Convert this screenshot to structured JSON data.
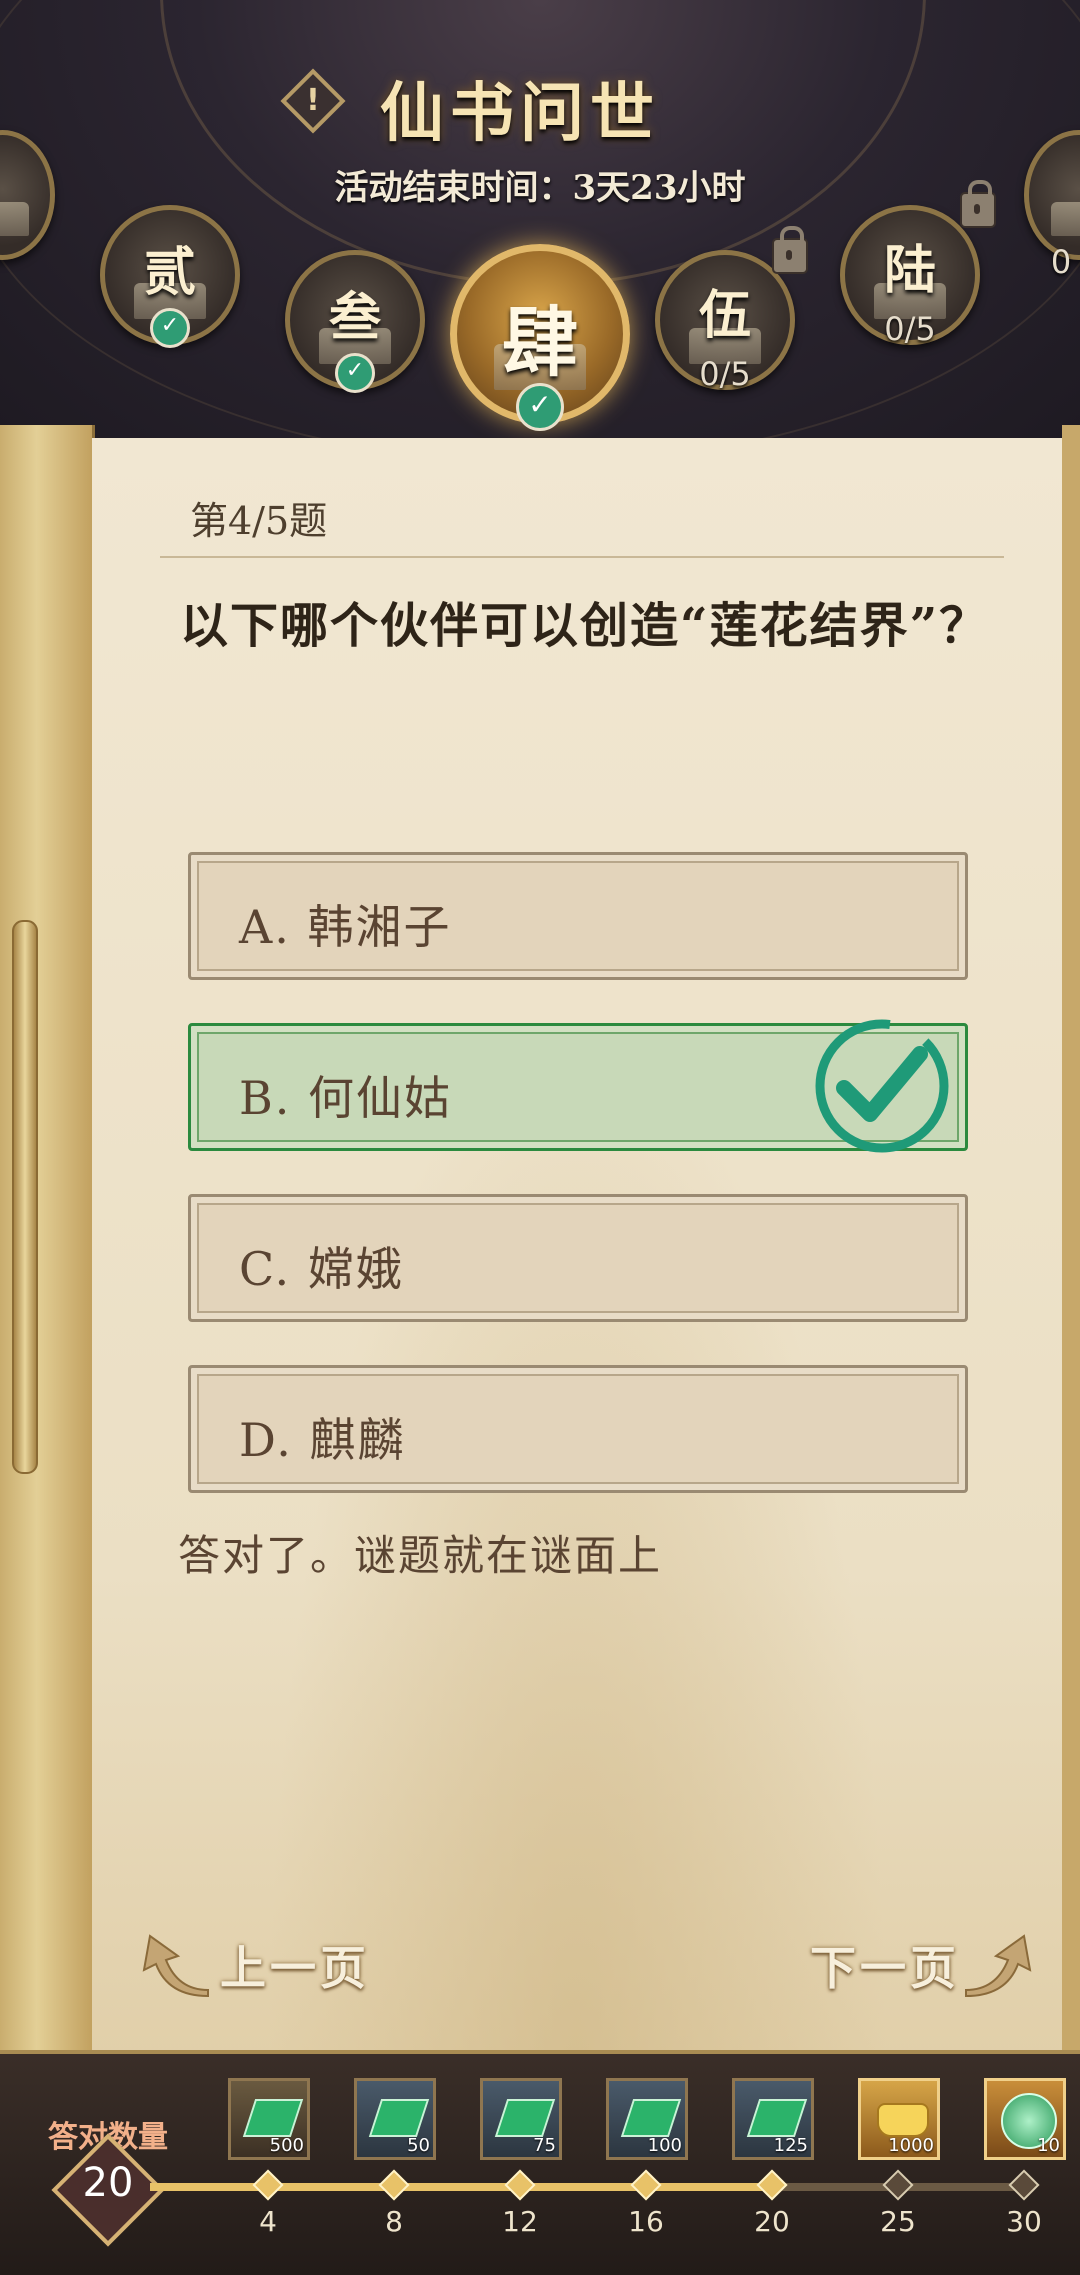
{
  "header": {
    "title": "仙书问世",
    "timer_label": "活动结束时间：",
    "timer_value": "3天23小时",
    "info_symbol": "!"
  },
  "chapters": [
    {
      "label": "",
      "status": "completed"
    },
    {
      "label": "贰",
      "status": "completed"
    },
    {
      "label": "叁",
      "status": "completed"
    },
    {
      "label": "肆",
      "status": "completed-current"
    },
    {
      "label": "伍",
      "progress": "0/5",
      "status": "locked"
    },
    {
      "label": "陆",
      "progress": "0/5",
      "status": "locked"
    },
    {
      "label": "",
      "progress": "0",
      "status": "locked"
    }
  ],
  "question": {
    "number_label": "第4/5题",
    "text": "以下哪个伙伴可以创造“莲花结界”？",
    "options": [
      {
        "label": "A. 韩湘子",
        "state": "normal"
      },
      {
        "label": "B. 何仙姑",
        "state": "correct"
      },
      {
        "label": "C. 嫦娥",
        "state": "normal"
      },
      {
        "label": "D. 麒麟",
        "state": "normal"
      }
    ],
    "feedback": "答对了。谜题就在谜面上"
  },
  "navigation": {
    "prev_label": "上一页",
    "next_label": "下一页"
  },
  "rewards_bar": {
    "count_label": "答对数量",
    "count_value": "20",
    "milestones": [
      {
        "label": "4",
        "reached": true
      },
      {
        "label": "8",
        "reached": true
      },
      {
        "label": "12",
        "reached": true
      },
      {
        "label": "16",
        "reached": true
      },
      {
        "label": "20",
        "reached": true
      },
      {
        "label": "25",
        "reached": false
      },
      {
        "label": "30",
        "reached": false
      }
    ],
    "rewards": [
      {
        "icon": "ticket-icon",
        "qty": "500"
      },
      {
        "icon": "ticket-icon",
        "qty": "50"
      },
      {
        "icon": "ticket-icon",
        "qty": "75"
      },
      {
        "icon": "ticket-icon",
        "qty": "100"
      },
      {
        "icon": "ticket-icon",
        "qty": "125"
      },
      {
        "icon": "gold-ingot-icon",
        "qty": "1000"
      },
      {
        "icon": "jade-orb-icon",
        "qty": "10"
      }
    ]
  },
  "colors": {
    "correct_green": "#2b8a3e",
    "gold_accent": "#e8c268",
    "checkmark_teal": "#2f9c74"
  }
}
